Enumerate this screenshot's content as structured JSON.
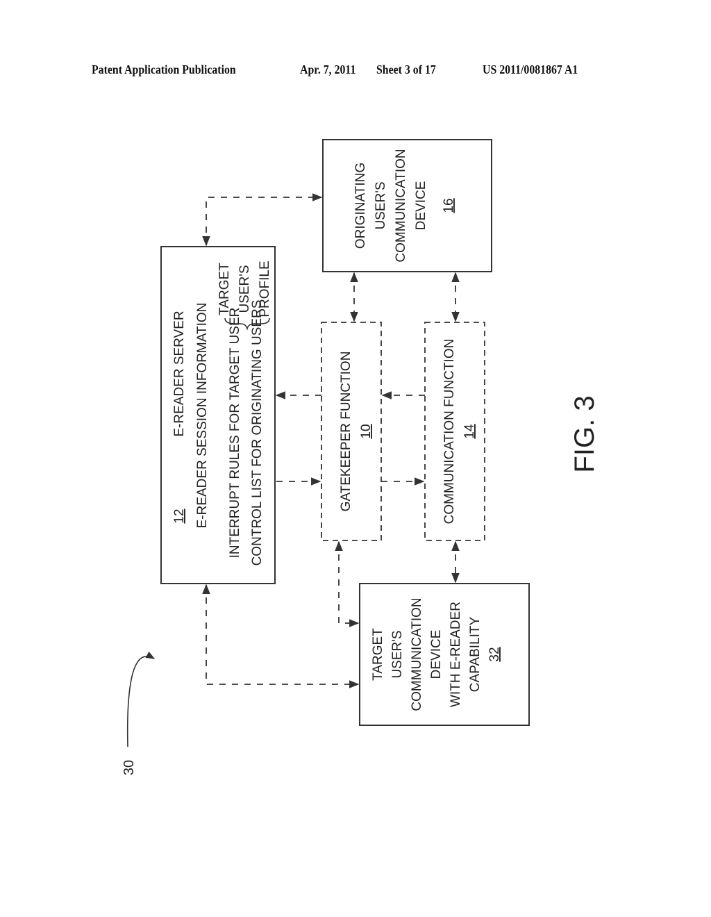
{
  "header": {
    "publication": "Patent Application Publication",
    "date": "Apr. 7, 2011",
    "sheet": "Sheet 3 of 17",
    "number": "US 2011/0081867 A1"
  },
  "figure": {
    "label": "FIG. 3",
    "system_ref": "30",
    "server": {
      "title": "E-READER SERVER",
      "ref": "12",
      "session_info": "E-READER SESSION INFORMATION",
      "profile_label": [
        "TARGET",
        "USER'S",
        "PROFILE"
      ],
      "profile_items": [
        "INTERRUPT RULES FOR TARGET USER",
        "CONTROL LIST FOR ORIGINATING USERS"
      ]
    },
    "originating_device": {
      "lines": [
        "ORIGINATING",
        "USER'S",
        "COMMUNICATION",
        "DEVICE"
      ],
      "ref": "16"
    },
    "gatekeeper": {
      "title": "GATEKEEPER FUNCTION",
      "ref": "10"
    },
    "communication_function": {
      "title": "COMMUNICATION FUNCTION",
      "ref": "14"
    },
    "target_device": {
      "lines": [
        "TARGET",
        "USER'S",
        "COMMUNICATION",
        "DEVICE",
        "WITH E-READER",
        "CAPABILITY"
      ],
      "ref": "32"
    }
  }
}
